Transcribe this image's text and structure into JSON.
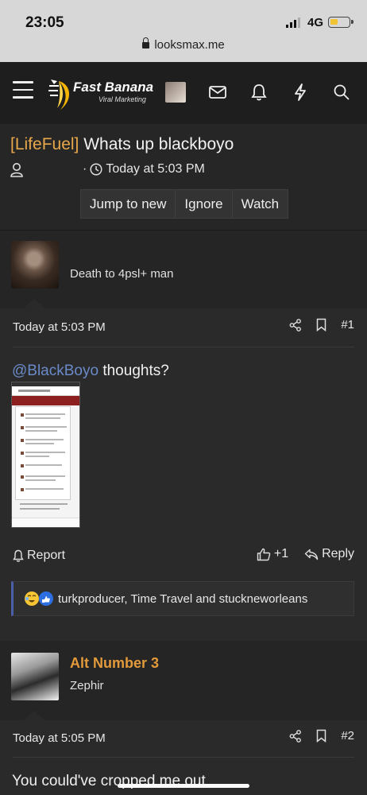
{
  "statusbar": {
    "time": "23:05",
    "network": "4G",
    "battery_level": 0.45,
    "url": "looksmax.me"
  },
  "site": {
    "logo_name": "Fast Banana",
    "logo_tagline": "Viral Marketing",
    "brand_color": "#f5b400"
  },
  "thread": {
    "prefix": "[LifeFuel]",
    "title": "Whats up blackboyo",
    "date": "Today at 5:03 PM",
    "buttons": [
      "Jump to new",
      "Ignore",
      "Watch"
    ]
  },
  "posts": [
    {
      "user_title": "Death to 4psl+ man",
      "date": "Today at 5:03 PM",
      "number": "#1",
      "mention": "@BlackBoyo",
      "text": " thoughts?",
      "report_label": "Report",
      "like_count": "+1",
      "reply_label": "Reply",
      "reactions_text": "turkproducer, Time Travel and stuckneworleans"
    },
    {
      "username": "Alt Number 3",
      "user_title": "Zephir",
      "date": "Today at 5:05 PM",
      "number": "#2",
      "text": "You could've cropped me out"
    }
  ],
  "colors": {
    "prefix": "#e8a74a",
    "mention": "#6a8ac8",
    "username": "#e39a3b",
    "reaction_accent": "#4b5fa8"
  }
}
